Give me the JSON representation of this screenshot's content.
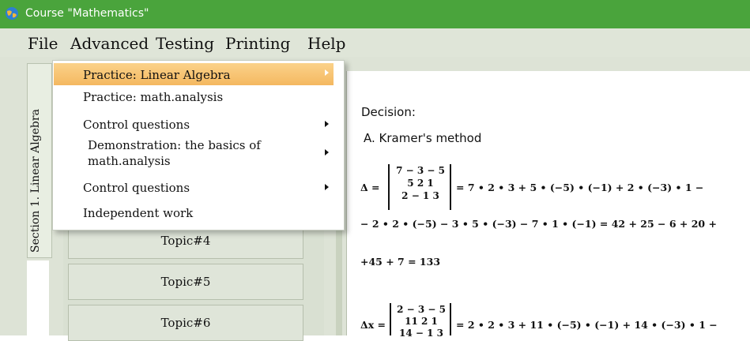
{
  "window": {
    "title": "Course \"Mathematics\""
  },
  "menu": [
    "File",
    "Advanced",
    "Testing",
    "Printing",
    "Help"
  ],
  "sidebar": {
    "tab_label": "Section 1. Linear Algebra"
  },
  "topics": [
    "Topic#4",
    "Topic#5",
    "Topic#6"
  ],
  "dropdown": {
    "items": [
      {
        "label": "Practice: Linear Algebra",
        "has_submenu": true,
        "highlighted": true
      },
      {
        "label": "Practice: math.analysis",
        "has_submenu": false
      },
      {
        "label": "Control questions",
        "has_submenu": true
      },
      {
        "label_line1": "Demonstration: the basics of",
        "label_line2": "math.analysis",
        "has_submenu": true
      },
      {
        "label": "Control questions",
        "has_submenu": true
      },
      {
        "label": "Independent work",
        "has_submenu": false
      }
    ]
  },
  "content": {
    "decision_label": "Decision:",
    "method_label": "A. Kramer's method",
    "delta_symbol": "Δ =",
    "delta_matrix": [
      "7 − 3 − 5",
      "5 2 1",
      "2 − 1 3"
    ],
    "delta_expansion": "= 7 • 2 • 3 + 5 • (−5) • (−1) + 2 • (−3) • 1 −",
    "line2": "− 2 • 2 • (−5) − 3 • 5 • (−3) − 7 • 1 • (−1) = 42 + 25 − 6 + 20 +",
    "line3": "+45 + 7 = 133",
    "dx_symbol": "Δx =",
    "dx_matrix": [
      "2 − 3 − 5",
      "11 2 1",
      "14 − 1 3"
    ],
    "dx_expansion": "= 2 • 2 • 3 + 11 • (−5) • (−1) + 14 • (−3) • 1 −"
  },
  "colors": {
    "titlebar": "#4aa43c",
    "highlight": "#f4b860"
  },
  "icons": {
    "app": "globe-icon",
    "submenu": "submenu-arrow-icon"
  }
}
